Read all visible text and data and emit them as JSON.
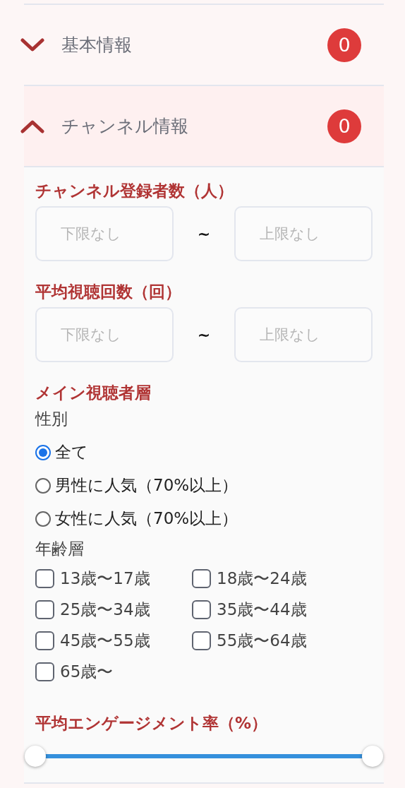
{
  "sections": [
    {
      "title": "基本情報",
      "count": "0",
      "expanded": false
    },
    {
      "title": "チャンネル情報",
      "count": "0",
      "expanded": true
    }
  ],
  "filters": {
    "subscribers": {
      "label": "チャンネル登録者数（人）",
      "min_placeholder": "下限なし",
      "separator": "~",
      "max_placeholder": "上限なし"
    },
    "views": {
      "label": "平均視聴回数（回）",
      "min_placeholder": "下限なし",
      "separator": "~",
      "max_placeholder": "上限なし"
    },
    "audience": {
      "label": "メイン視聴者層",
      "gender_label": "性別",
      "genders": [
        {
          "label": "全て",
          "selected": true
        },
        {
          "label": "男性に人気（70%以上）",
          "selected": false
        },
        {
          "label": "女性に人気（70%以上）",
          "selected": false
        }
      ],
      "age_label": "年齢層",
      "ages": [
        {
          "label": "13歳〜17歳",
          "checked": false
        },
        {
          "label": "18歳〜24歳",
          "checked": false
        },
        {
          "label": "25歳〜34歳",
          "checked": false
        },
        {
          "label": "35歳〜44歳",
          "checked": false
        },
        {
          "label": "45歳〜55歳",
          "checked": false
        },
        {
          "label": "55歳〜64歳",
          "checked": false
        },
        {
          "label": "65歳〜",
          "checked": false
        }
      ]
    },
    "engagement": {
      "label": "平均エンゲージメント率（%）",
      "thumbs": [
        {
          "level": 0
        },
        {
          "level": 1
        }
      ]
    }
  }
}
